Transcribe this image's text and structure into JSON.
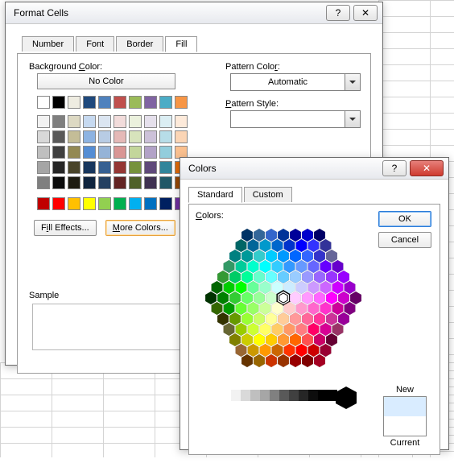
{
  "format_cells": {
    "title": "Format Cells",
    "tabs": {
      "number": "Number",
      "font": "Font",
      "border": "Border",
      "fill": "Fill"
    },
    "active_tab": "Fill",
    "bg_color_label": "Background Color:",
    "no_color": "No Color",
    "theme_rows": [
      [
        "#ffffff",
        "#000000",
        "#eeece1",
        "#1f497d",
        "#4f81bd",
        "#c0504d",
        "#9bbb59",
        "#8064a2",
        "#4bacc6",
        "#f79646"
      ],
      [
        "#f2f2f2",
        "#7f7f7f",
        "#ddd9c3",
        "#c6d9f0",
        "#dbe5f1",
        "#f2dcdb",
        "#ebf1dd",
        "#e5e0ec",
        "#dbeef3",
        "#fdeada"
      ],
      [
        "#d8d8d8",
        "#595959",
        "#c4bd97",
        "#8db3e2",
        "#b8cce4",
        "#e5b9b7",
        "#d7e3bc",
        "#ccc1d9",
        "#b7dde8",
        "#fbd5b5"
      ],
      [
        "#bfbfbf",
        "#3f3f3f",
        "#938953",
        "#548dd4",
        "#95b3d7",
        "#d99694",
        "#c3d69b",
        "#b2a2c7",
        "#92cddc",
        "#fac08f"
      ],
      [
        "#a5a5a5",
        "#262626",
        "#494429",
        "#17365d",
        "#366092",
        "#953734",
        "#76923c",
        "#5f497a",
        "#31859b",
        "#e36c09"
      ],
      [
        "#7f7f7f",
        "#0c0c0c",
        "#1d1b10",
        "#0f243e",
        "#244061",
        "#632423",
        "#4f6128",
        "#3f3151",
        "#205867",
        "#974806"
      ]
    ],
    "standard_row": [
      "#c00000",
      "#ff0000",
      "#ffc000",
      "#ffff00",
      "#92d050",
      "#00b050",
      "#00b0f0",
      "#0070c0",
      "#002060",
      "#7030a0"
    ],
    "fill_effects": "Fill Effects...",
    "more_colors": "More Colors...",
    "pattern_color_label": "Pattern Color:",
    "pattern_color_value": "Automatic",
    "pattern_style_label": "Pattern Style:",
    "sample_label": "Sample"
  },
  "colors_dialog": {
    "title": "Colors",
    "tabs": {
      "standard": "Standard",
      "custom": "Custom"
    },
    "active_tab": "Standard",
    "colors_label": "Colors:",
    "ok": "OK",
    "cancel": "Cancel",
    "new_label": "New",
    "current_label": "Current",
    "gray_swatches": [
      "#ffffff",
      "#f2f2f2",
      "#d9d9d9",
      "#bfbfbf",
      "#a6a6a6",
      "#808080",
      "#595959",
      "#404040",
      "#262626",
      "#0d0d0d",
      "#000000",
      "#000000"
    ],
    "hexagon": {
      "rows": [
        [
          "#003366",
          "#336699",
          "#3366CC",
          "#003399",
          "#000099",
          "#0000CC",
          "#000066"
        ],
        [
          "#006666",
          "#006699",
          "#0099CC",
          "#0066CC",
          "#0033CC",
          "#0000FF",
          "#3333FF",
          "#333399"
        ],
        [
          "#008080",
          "#009999",
          "#33CCCC",
          "#00CCFF",
          "#0099FF",
          "#0066FF",
          "#3366FF",
          "#3333CC",
          "#666699"
        ],
        [
          "#339966",
          "#00CC99",
          "#00FFCC",
          "#00FFFF",
          "#33CCFF",
          "#3399FF",
          "#6699FF",
          "#6666FF",
          "#6600FF",
          "#6600CC"
        ],
        [
          "#339933",
          "#00CC66",
          "#00FF99",
          "#66FFCC",
          "#66FFFF",
          "#66CCFF",
          "#99CCFF",
          "#9999FF",
          "#9966FF",
          "#9933FF",
          "#9900FF"
        ],
        [
          "#006600",
          "#00CC00",
          "#00FF00",
          "#66FF99",
          "#99FFCC",
          "#CCFFFF",
          "#CCECFF",
          "#CCCCFF",
          "#CC99FF",
          "#CC66FF",
          "#CC00FF",
          "#9900CC"
        ],
        [
          "#003300",
          "#008000",
          "#33CC33",
          "#66FF66",
          "#99FF99",
          "#CCFFCC",
          "#FFFFFF",
          "#FFCCFF",
          "#FF99FF",
          "#FF66FF",
          "#FF00FF",
          "#CC00CC",
          "#660066"
        ],
        [
          "#336600",
          "#009900",
          "#66FF33",
          "#99FF66",
          "#CCFF99",
          "#FFFFCC",
          "#FFCCCC",
          "#FF99CC",
          "#FF66CC",
          "#FF33CC",
          "#CC0099",
          "#800080"
        ],
        [
          "#333300",
          "#669900",
          "#99FF33",
          "#CCFF66",
          "#FFFF99",
          "#FFCC99",
          "#FF9999",
          "#FF6699",
          "#FF3399",
          "#CC3399",
          "#990099"
        ],
        [
          "#666633",
          "#99CC00",
          "#CCFF33",
          "#FFFF66",
          "#FFCC66",
          "#FF9966",
          "#FF7C80",
          "#FF0066",
          "#D60093",
          "#993366"
        ],
        [
          "#808000",
          "#CCCC00",
          "#FFFF00",
          "#FFCC00",
          "#FF9933",
          "#FF6600",
          "#FF5050",
          "#CC0066",
          "#660033"
        ],
        [
          "#996633",
          "#CC9900",
          "#FF9900",
          "#CC6600",
          "#FF3300",
          "#FF0000",
          "#CC0000",
          "#990033"
        ],
        [
          "#663300",
          "#996600",
          "#CC3300",
          "#993300",
          "#990000",
          "#800000",
          "#A50021"
        ]
      ]
    }
  }
}
